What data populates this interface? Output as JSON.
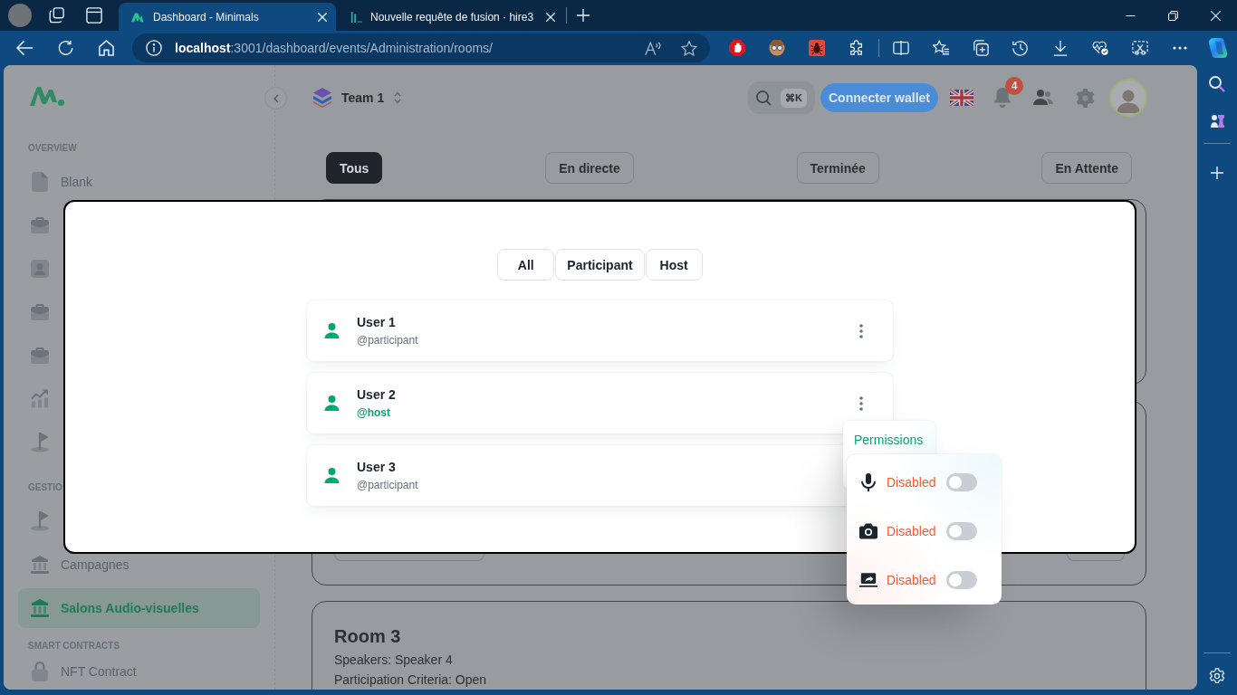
{
  "browser": {
    "tabs": [
      {
        "title": "Dashboard - Minimals",
        "selected": true
      },
      {
        "title": "Nouvelle requête de fusion · hire3",
        "selected": false
      }
    ],
    "address": {
      "host": "localhost",
      "path": ":3001/dashboard/events/Administration/rooms/"
    }
  },
  "sidebar": {
    "sections": [
      {
        "title": "OVERVIEW",
        "items": [
          {
            "kind": "file",
            "label": "Blank",
            "selected": false
          },
          {
            "kind": "briefcase",
            "selected": false
          },
          {
            "kind": "contact",
            "selected": false
          },
          {
            "kind": "briefcase",
            "selected": false
          },
          {
            "kind": "briefcase",
            "selected": false
          },
          {
            "kind": "chart",
            "selected": false
          },
          {
            "kind": "flag",
            "selected": false
          }
        ]
      },
      {
        "title": "GESTIO",
        "items": [
          {
            "kind": "flag",
            "selected": false
          },
          {
            "kind": "bank",
            "label": "Campagnes",
            "selected": false
          },
          {
            "kind": "bank",
            "label": "Salons Audio-visuelles",
            "selected": true
          }
        ]
      },
      {
        "title": "SMART CONTRACTS",
        "items": [
          {
            "kind": "lock",
            "label": "NFT Contract",
            "selected": false
          }
        ]
      }
    ]
  },
  "header": {
    "workspace": "Team 1",
    "search_shortcut": "⌘K",
    "wallet_button": "Connecter wallet",
    "notification_count": "4"
  },
  "filters": [
    {
      "label": "Tous",
      "selected": true
    },
    {
      "label": "En directe",
      "selected": false
    },
    {
      "label": "Terminée",
      "selected": false
    },
    {
      "label": "En Attente",
      "selected": false
    }
  ],
  "rooms": [
    {
      "title": "Room 3",
      "details": [
        "Speakers: Speaker 4",
        "Participation Criteria: Open"
      ]
    }
  ],
  "modal": {
    "tabs": [
      {
        "label": "All",
        "selected": false
      },
      {
        "label": "Participant",
        "selected": false
      },
      {
        "label": "Host",
        "selected": false
      }
    ],
    "users": [
      {
        "name": "User 1",
        "role": "@participant",
        "kind": "participant"
      },
      {
        "name": "User 2",
        "role": "@host",
        "kind": "host"
      },
      {
        "name": "User 3",
        "role": "@participant",
        "kind": "participant"
      }
    ]
  },
  "permissions_menu": {
    "title": "Permissions",
    "rows": [
      {
        "kind": "microphone",
        "status": "Disabled",
        "on": false
      },
      {
        "kind": "camera",
        "status": "Disabled",
        "on": false
      },
      {
        "kind": "screen_share",
        "status": "Disabled",
        "on": false
      }
    ]
  }
}
